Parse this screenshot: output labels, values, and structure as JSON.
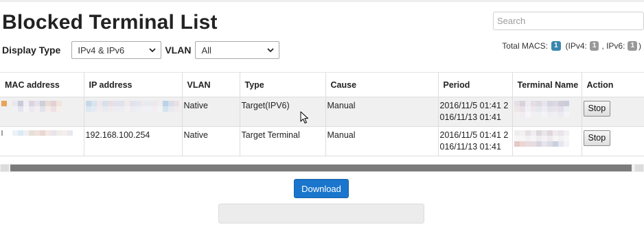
{
  "page": {
    "title": "Blocked Terminal List"
  },
  "search": {
    "placeholder": "Search",
    "value": ""
  },
  "filters": {
    "display_type_label": "Display Type",
    "display_type_value": "IPv4 & IPv6",
    "vlan_label": "VLAN",
    "vlan_value": "All"
  },
  "totals": {
    "label": "Total MACS:",
    "total": "1",
    "ipv4_label": "(IPv4:",
    "ipv4": "1",
    "ipv6_label": ", IPv6:",
    "ipv6": "1",
    "close": ")"
  },
  "table": {
    "columns": [
      "MAC address",
      "IP address",
      "VLAN",
      "Type",
      "Cause",
      "Period",
      "Terminal Name",
      "Action"
    ],
    "rows": [
      {
        "mac": "",
        "ip": "",
        "vlan": "Native",
        "type": "Target(IPV6)",
        "cause": "Manual",
        "period": "2016/11/5 01:41 2\n016/11/13 01:41",
        "terminal_name": "",
        "action": "Stop"
      },
      {
        "mac": "",
        "ip": "192.168.100.254",
        "vlan": "Native",
        "type": "Target Terminal",
        "cause": "Manual",
        "period": "2016/11/5 01:41 2\n016/11/13 01:41",
        "terminal_name": "",
        "action": "Stop"
      }
    ]
  },
  "actions": {
    "download_label": "Download"
  },
  "icons": {
    "select_arrow": "chevron-down-icon",
    "cursor": "mouse-cursor-icon"
  },
  "colors": {
    "primary": "#1a75cc",
    "badge_total": "#3a87ad",
    "badge_gray": "#999999",
    "selected_row": "#f0f0f0"
  }
}
